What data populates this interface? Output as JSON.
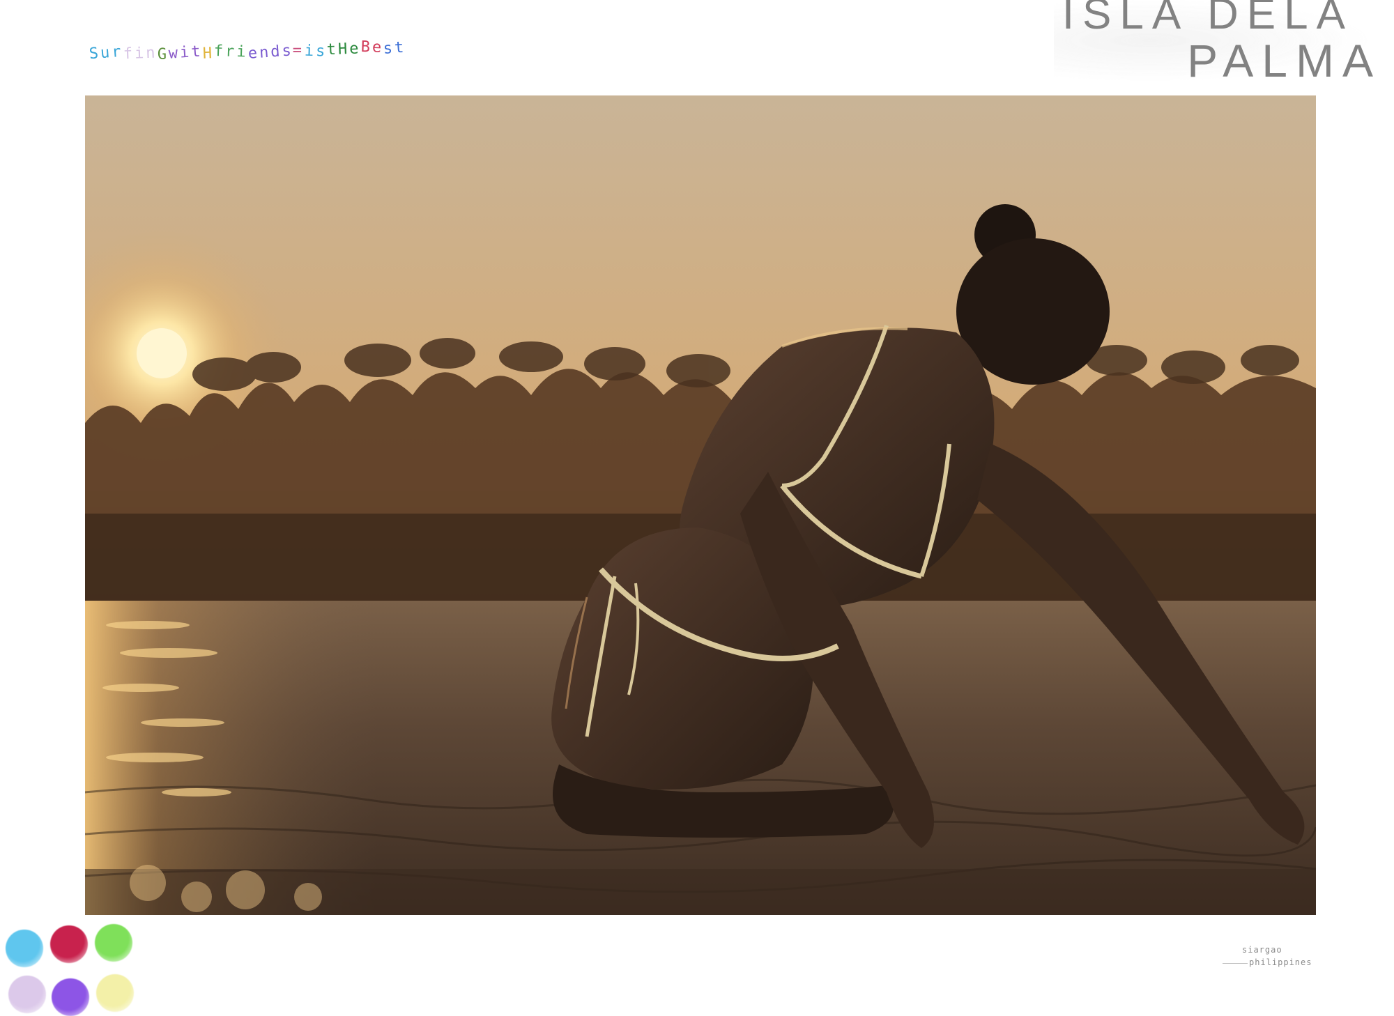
{
  "caption": {
    "parts": [
      {
        "text": "Sur",
        "color": "#3aa6d8"
      },
      {
        "text": "fin",
        "color": "#d8c6e6"
      },
      {
        "text": "G",
        "color": "#5a8f3a"
      },
      {
        "text": "  ",
        "color": "#ffffff"
      },
      {
        "text": "wit",
        "color": "#8b5bc9"
      },
      {
        "text": "H",
        "color": "#e0b43a"
      },
      {
        "text": " ",
        "color": "#ffffff"
      },
      {
        "text": "fri",
        "color": "#4aa35a"
      },
      {
        "text": "ends",
        "color": "#7a5bd0"
      },
      {
        "text": " ",
        "color": "#ffffff"
      },
      {
        "text": "=",
        "color": "#c94b7a"
      },
      {
        "text": "is",
        "color": "#3aa6d8"
      },
      {
        "text": " ",
        "color": "#ffffff"
      },
      {
        "text": "tHe",
        "color": "#2c8a3e"
      },
      {
        "text": "  ",
        "color": "#ffffff"
      },
      {
        "text": "Be",
        "color": "#d23d5b"
      },
      {
        "text": "st",
        "color": "#3c6fd6"
      }
    ]
  },
  "stamp_title": {
    "line1": "ISLA DELA",
    "line2": "PALMA"
  },
  "photo": {
    "description_icon": "sunset-surf-photo",
    "sky_top": "#c7ad8f",
    "sky_bottom": "#d6a56a",
    "sun_color": "#fff2c2",
    "trees_color": "#4a3220",
    "water_color": "#5a4434",
    "skin_color": "#3b2a20",
    "bikini_color": "#d9c89a"
  },
  "swatches": {
    "colors": [
      "#5fc6ee",
      "#c8224d",
      "#7fe05a",
      "#dcc9ea",
      "#8d55e6",
      "#f3f0a8"
    ]
  },
  "location": {
    "line1": "siargao",
    "line2": "philippines"
  }
}
